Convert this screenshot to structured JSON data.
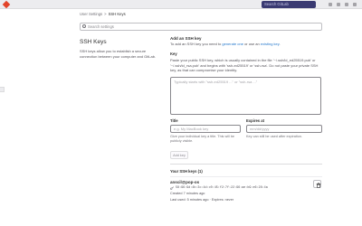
{
  "topbar": {
    "search_placeholder": "Search GitLab"
  },
  "breadcrumb": {
    "parent": "User Settings",
    "separator": ">",
    "current": "SSH Keys"
  },
  "settings_search": {
    "placeholder": "Search settings"
  },
  "intro": {
    "title": "SSH Keys",
    "description": "SSH keys allow you to establish a secure connection between your computer and GitLab."
  },
  "add_key": {
    "heading": "Add an SSH key",
    "text_before": "To add an SSH key you need to ",
    "generate_link": "generate one",
    "text_middle": " or use an ",
    "existing_link": "existing key",
    "text_after": ".",
    "key_label": "Key",
    "key_help": "Paste your public SSH key, which is usually contained in the file '~/.ssh/id_ed25519.pub' or '~/.ssh/id_rsa.pub' and begins with 'ssh-ed25519' or 'ssh-rsa'. Do not paste your private SSH key, as that can compromise your identity.",
    "key_placeholder": "Typically starts with \"ssh-ed25519 ...\" or \"ssh-rsa ...\"",
    "title_label": "Title",
    "title_placeholder": "e.g. My MacBook key",
    "title_help": "Give your individual key a title. This will be publicly visible.",
    "expires_label": "Expires at",
    "expires_placeholder": "mm/dd/yyyy",
    "expires_help": "Key can still be used after expiration.",
    "add_button": "Add key"
  },
  "your_keys": {
    "title": "Your SSH keys (1)",
    "keys": [
      {
        "name": "anscil@pop-os",
        "fingerprint": "58:96:9d:4b:3c:4d:c0:45:f2:7f:22:96:ae:b9:e6:28:4a",
        "created": "Created 7 minutes ago",
        "last_used": "Last used: 5 minutes ago",
        "expires": "Expires: never"
      }
    ]
  },
  "colors": {
    "link": "#1f75cb",
    "topbar_search_bg": "#3a3a72",
    "logo": "#e24329"
  }
}
